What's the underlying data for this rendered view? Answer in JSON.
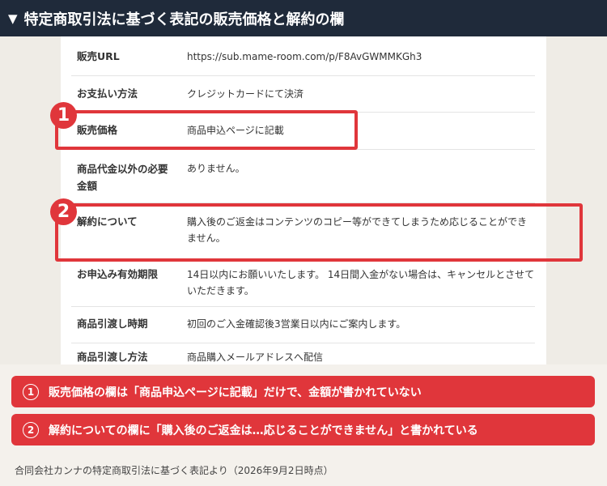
{
  "header": {
    "icon": "triangle-down-icon",
    "toggle": "▼",
    "title": "特定商取引法に基づく表記の販売価格と解約の欄"
  },
  "rows": [
    {
      "label": "販売URL",
      "value": "https://sub.mame-room.com/p/F8AvGWMMKGh3"
    },
    {
      "label": "お支払い方法",
      "value": "クレジットカードにて決済"
    },
    {
      "label": "販売価格",
      "value": "商品申込ページに記載"
    },
    {
      "label": "商品代金以外の必要金額",
      "value": "ありません。"
    },
    {
      "label": "解約について",
      "value": "購入後のご返金はコンテンツのコピー等ができてしまうため応じることができません。"
    },
    {
      "label": "お申込み有効期限",
      "value": "14日以内にお願いいたします。 14日間入金がない場合は、キャンセルとさせていただきます。"
    },
    {
      "label": "商品引渡し時期",
      "value": "初回のご入金確認後3営業日以内にご案内します。"
    },
    {
      "label": "商品引渡し方法",
      "value": "商品購入メールアドレスへ配信"
    }
  ],
  "badges": [
    "1",
    "2"
  ],
  "notes": [
    {
      "num": "1",
      "text": "販売価格の欄は「商品申込ページに記載」だけで、金額が書かれていない"
    },
    {
      "num": "2",
      "text": "解約についての欄に「購入後のご返金は…応じることができません」と書かれている"
    }
  ],
  "footer": "合同会社カンナの特定商取引法に基づく表記より（2026年9月2日時点）",
  "colors": {
    "header_bg": "#1f2a3a",
    "accent_red": "#e0363b",
    "page_bg": "#f4f1ec"
  }
}
